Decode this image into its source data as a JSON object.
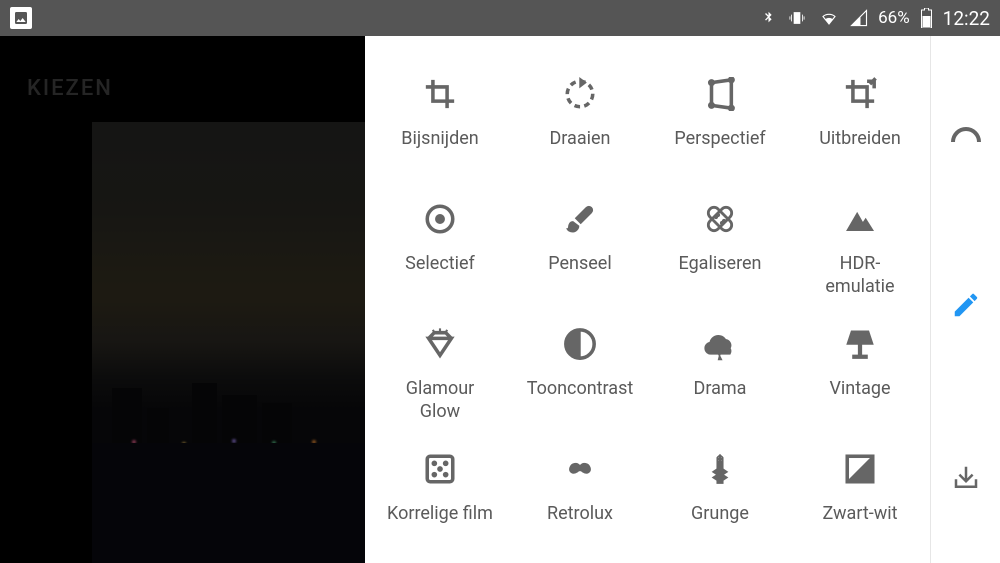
{
  "status": {
    "battery": "66%",
    "time": "12:22"
  },
  "left": {
    "heading": "KIEZEN"
  },
  "tools": [
    {
      "id": "crop",
      "label": "Bijsnijden",
      "icon": "crop"
    },
    {
      "id": "rotate",
      "label": "Draaien",
      "icon": "rotate"
    },
    {
      "id": "perspective",
      "label": "Perspectief",
      "icon": "perspective"
    },
    {
      "id": "expand",
      "label": "Uitbreiden",
      "icon": "expand"
    },
    {
      "id": "selective",
      "label": "Selectief",
      "icon": "target"
    },
    {
      "id": "brush",
      "label": "Penseel",
      "icon": "brush"
    },
    {
      "id": "healing",
      "label": "Egaliseren",
      "icon": "bandaid"
    },
    {
      "id": "hdr",
      "label": "HDR-\nemulatie",
      "icon": "mountains"
    },
    {
      "id": "glamour",
      "label": "Glamour\nGlow",
      "icon": "diamond"
    },
    {
      "id": "tonal",
      "label": "Tooncontrast",
      "icon": "halfcircle"
    },
    {
      "id": "drama",
      "label": "Drama",
      "icon": "cloud"
    },
    {
      "id": "vintage",
      "label": "Vintage",
      "icon": "lamp"
    },
    {
      "id": "grainy",
      "label": "Korrelige film",
      "icon": "film"
    },
    {
      "id": "retrolux",
      "label": "Retrolux",
      "icon": "mustache"
    },
    {
      "id": "grunge",
      "label": "Grunge",
      "icon": "guitar"
    },
    {
      "id": "bw",
      "label": "Zwart-wit",
      "icon": "bwsquare"
    }
  ],
  "rail": {
    "styles": "styles",
    "edit": "edit",
    "export": "export"
  }
}
